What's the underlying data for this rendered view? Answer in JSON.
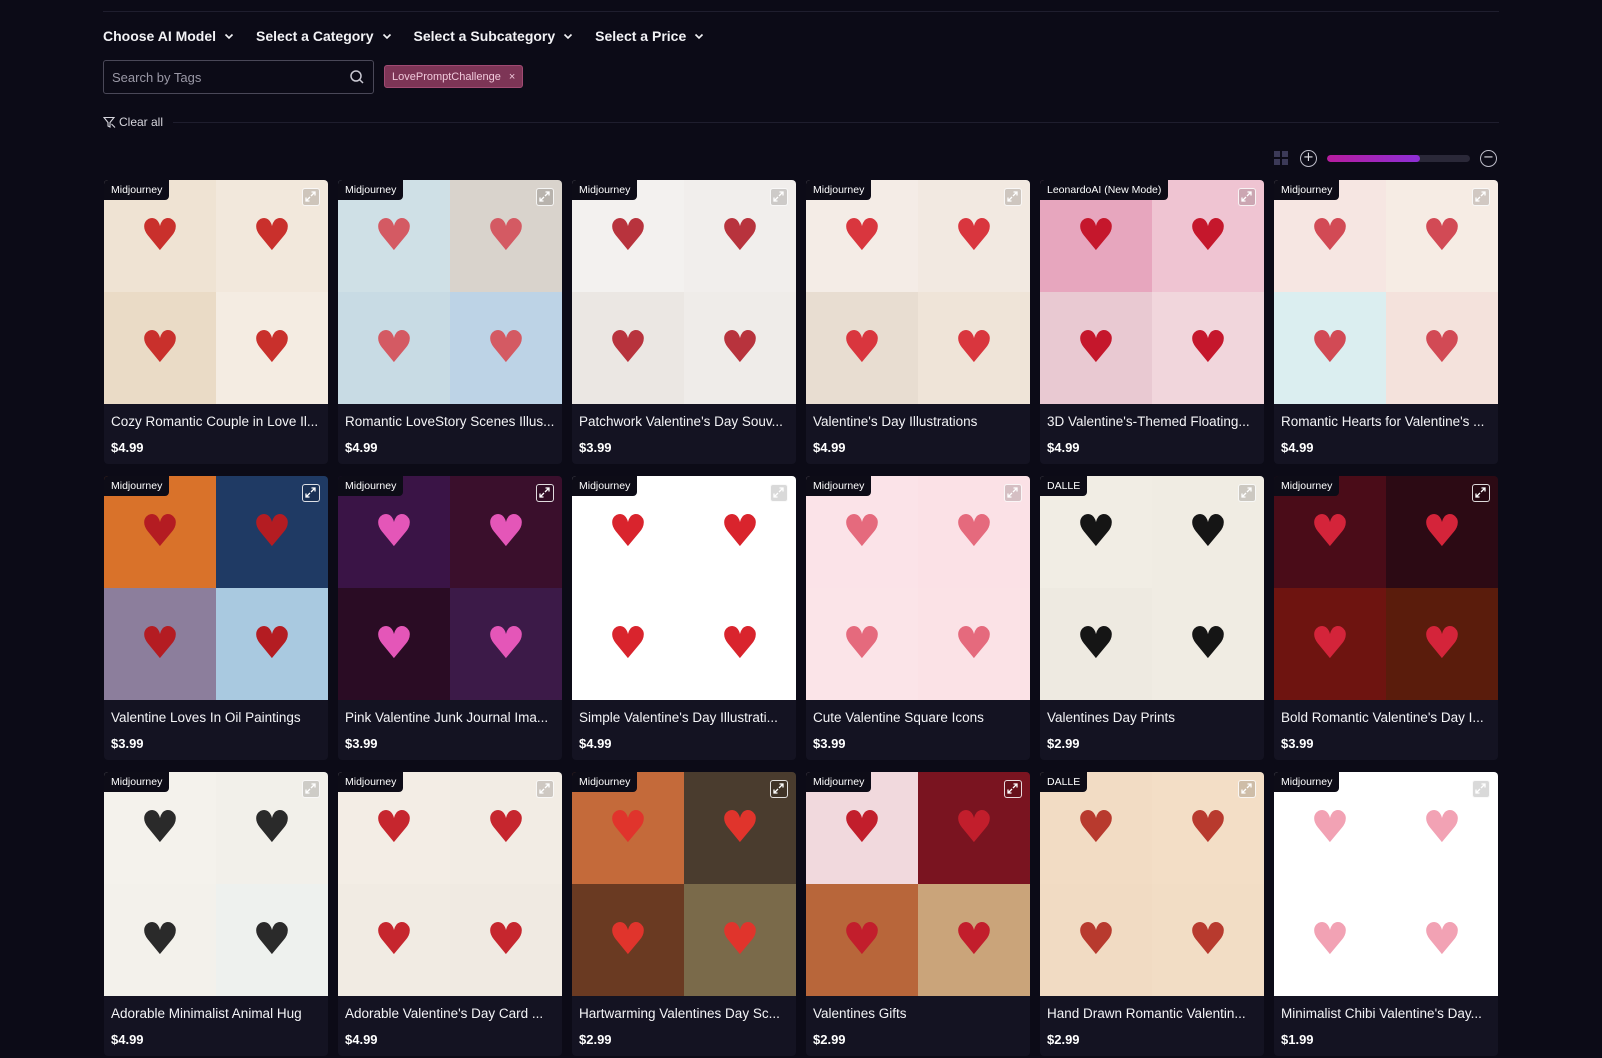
{
  "filters": {
    "ai_model": "Choose AI Model",
    "category": "Select a Category",
    "subcategory": "Select a Subcategory",
    "price": "Select a Price"
  },
  "search": {
    "placeholder": "Search by Tags",
    "value": ""
  },
  "active_tag": {
    "label": "LovePromptChallenge",
    "remove": "×"
  },
  "clear_all": "Clear all",
  "view": {
    "zoom_in": "+",
    "zoom_out": "−",
    "zoom_level": 0.65,
    "accent_from": "#b81c9e",
    "accent_to": "#8d2fd6"
  },
  "products": [
    {
      "model": "Midjourney",
      "title": "Cozy Romantic Couple in Love Il...",
      "price": "$4.99",
      "colors": [
        "#efe3d3",
        "#f2e8dc",
        "#eadbc6",
        "#f4ece2"
      ],
      "motifs": [
        "♥",
        "♥",
        "♥",
        "♥"
      ],
      "motif_color": "#c9302c"
    },
    {
      "model": "Midjourney",
      "title": "Romantic LoveStory Scenes Illus...",
      "price": "$4.99",
      "colors": [
        "#cfe0e6",
        "#d9d3cc",
        "#c8dbe4",
        "#bdd3e6"
      ],
      "motifs": [
        "♥",
        "♥",
        "♥",
        "♥"
      ],
      "motif_color": "#d45a63"
    },
    {
      "model": "Midjourney",
      "title": "Patchwork Valentine's Day Souv...",
      "price": "$3.99",
      "colors": [
        "#f3f1ef",
        "#f1eeec",
        "#ebe7e3",
        "#efece9"
      ],
      "motifs": [
        "♥",
        "♥",
        "♥",
        "♥"
      ],
      "motif_color": "#b8333d"
    },
    {
      "model": "Midjourney",
      "title": "Valentine's Day Illustrations",
      "price": "$4.99",
      "colors": [
        "#f4ece6",
        "#f2e9e1",
        "#e8ddd1",
        "#efe4d8"
      ],
      "motifs": [
        "♥",
        "♥",
        "♥",
        "♥"
      ],
      "motif_color": "#d9363e"
    },
    {
      "model": "LeonardoAI (New Mode)",
      "title": "3D Valentine's-Themed Floating...",
      "price": "$4.99",
      "colors": [
        "#e7a6be",
        "#efc4d2",
        "#e9c9d2",
        "#f1d6dc"
      ],
      "motifs": [
        "♥",
        "♥",
        "♥",
        "♥"
      ],
      "motif_color": "#c5172c"
    },
    {
      "model": "Midjourney",
      "title": "Romantic Hearts for Valentine's ...",
      "price": "$4.99",
      "colors": [
        "#f6e6e2",
        "#f6ece4",
        "#dbeef0",
        "#f4e2dc"
      ],
      "motifs": [
        "♥",
        "♥",
        "♥",
        "♥"
      ],
      "motif_color": "#d24a55"
    },
    {
      "model": "Midjourney",
      "title": "Valentine Loves In Oil Paintings",
      "price": "$3.99",
      "colors": [
        "#d9722a",
        "#1f3a64",
        "#8c7e9c",
        "#a9c9e0"
      ],
      "motifs": [
        "♥",
        "♥",
        "♥",
        "♥"
      ],
      "motif_color": "#b41c22"
    },
    {
      "model": "Midjourney",
      "title": "Pink Valentine Junk Journal Ima...",
      "price": "$3.99",
      "colors": [
        "#3a1446",
        "#3a0f2c",
        "#2a0c24",
        "#3c1a48"
      ],
      "motifs": [
        "♥",
        "♥",
        "♥",
        "♥"
      ],
      "motif_color": "#e456b8"
    },
    {
      "model": "Midjourney",
      "title": "Simple Valentine's Day Illustrati...",
      "price": "$4.99",
      "colors": [
        "#ffffff",
        "#ffffff",
        "#ffffff",
        "#ffffff"
      ],
      "motifs": [
        "♥",
        "♥",
        "♥",
        "♥"
      ],
      "motif_color": "#d9242d"
    },
    {
      "model": "Midjourney",
      "title": "Cute Valentine Square Icons",
      "price": "$3.99",
      "colors": [
        "#fbe3e8",
        "#fbe1e6",
        "#fbe4e8",
        "#fbe2e6"
      ],
      "motifs": [
        "♥",
        "♥",
        "♥",
        "♥"
      ],
      "motif_color": "#e56a7d"
    },
    {
      "model": "DALLE",
      "title": "Valentines Day Prints",
      "price": "$2.99",
      "colors": [
        "#f1ede4",
        "#f0ece3",
        "#eeeae1",
        "#f0ece3"
      ],
      "motifs": [
        "♥",
        "♥",
        "♥",
        "♥"
      ],
      "motif_color": "#151515"
    },
    {
      "model": "Midjourney",
      "title": "Bold Romantic Valentine's Day I...",
      "price": "$3.99",
      "colors": [
        "#4a0c18",
        "#2c0a14",
        "#6e1410",
        "#5a1c0c"
      ],
      "motifs": [
        "♥",
        "♥",
        "♥",
        "♥"
      ],
      "motif_color": "#d4243a"
    },
    {
      "model": "Midjourney",
      "title": "Adorable Minimalist Animal Hug",
      "price": "$4.99",
      "colors": [
        "#f4f2ec",
        "#f2f0ea",
        "#f3f1eb",
        "#eef1ee"
      ],
      "motifs": [
        "♥",
        "♥",
        "♥",
        "♥"
      ],
      "motif_color": "#2a2a2a"
    },
    {
      "model": "Midjourney",
      "title": "Adorable Valentine's Day Card ...",
      "price": "$4.99",
      "colors": [
        "#f3ede5",
        "#f2ece4",
        "#f1ebe3",
        "#f0eae2"
      ],
      "motifs": [
        "♥",
        "♥",
        "♥",
        "♥"
      ],
      "motif_color": "#c6262e"
    },
    {
      "model": "Midjourney",
      "title": "Hartwarming Valentines Day Sc...",
      "price": "$2.99",
      "colors": [
        "#c46a3a",
        "#4a3c2e",
        "#6a3a22",
        "#7a6a4a"
      ],
      "motifs": [
        "♥",
        "♥",
        "♥",
        "♥"
      ],
      "motif_color": "#e0342c"
    },
    {
      "model": "Midjourney",
      "title": "Valentines Gifts",
      "price": "$2.99",
      "colors": [
        "#f1d9dd",
        "#7a1420",
        "#b8663a",
        "#caa47a"
      ],
      "motifs": [
        "♥",
        "♥",
        "♥",
        "♥"
      ],
      "motif_color": "#c21e2c"
    },
    {
      "model": "DALLE",
      "title": "Hand Drawn Romantic Valentin...",
      "price": "$2.99",
      "colors": [
        "#f2dcc4",
        "#f3dec6",
        "#f1dbc3",
        "#f2ddc5"
      ],
      "motifs": [
        "♥",
        "♥",
        "♥",
        "♥"
      ],
      "motif_color": "#b83a2e"
    },
    {
      "model": "Midjourney",
      "title": "Minimalist Chibi Valentine's Day...",
      "price": "$1.99",
      "colors": [
        "#ffffff",
        "#ffffff",
        "#ffffff",
        "#ffffff"
      ],
      "motifs": [
        "♥",
        "♥",
        "♥",
        "♥"
      ],
      "motif_color": "#f2a2b4"
    }
  ]
}
